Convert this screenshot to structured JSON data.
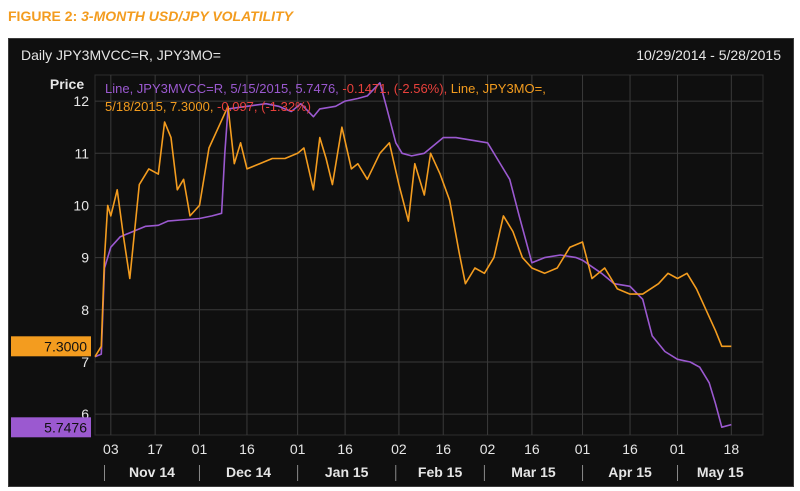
{
  "caption": {
    "figure": "FIGURE 2:",
    "title": "3-MONTH USD/JPY VOLATILITY"
  },
  "header": {
    "instrument": "Daily JPY3MVCC=R, JPY3MO=",
    "range": "10/29/2014 - 5/28/2015"
  },
  "legend": {
    "line1_purple": "Line, JPY3MVCC=R, 5/15/2015, 5.7476,",
    "line1_red": "-0.1471, (-2.56%),",
    "line1_orange": "Line, JPY3MO=,",
    "line2_orange": "5/18/2015, 7.3000,",
    "line2_red": "-0.097, (-1.32%)"
  },
  "colors": {
    "purple": "#9b59d0",
    "orange": "#f39c1f",
    "red": "#e8413c",
    "background": "#0f0f0f",
    "grid": "#3a3a3a",
    "text": "#e6e6e6",
    "caption": "#f39c1f"
  },
  "chart_data": {
    "type": "line",
    "ylabel": "Price",
    "ylim": [
      5.6,
      12.5
    ],
    "yticks": [
      6,
      7,
      8,
      9,
      10,
      11,
      12
    ],
    "x_start": "2014-10-29",
    "x_end": "2015-05-28",
    "xticks": [
      {
        "date": "2014-11-03",
        "label": "03"
      },
      {
        "date": "2014-11-17",
        "label": "17"
      },
      {
        "date": "2014-12-01",
        "label": "01"
      },
      {
        "date": "2014-12-16",
        "label": "16"
      },
      {
        "date": "2015-01-01",
        "label": "01"
      },
      {
        "date": "2015-01-16",
        "label": "16"
      },
      {
        "date": "2015-02-02",
        "label": "02"
      },
      {
        "date": "2015-02-16",
        "label": "16"
      },
      {
        "date": "2015-03-02",
        "label": "02"
      },
      {
        "date": "2015-03-16",
        "label": "16"
      },
      {
        "date": "2015-04-01",
        "label": "01"
      },
      {
        "date": "2015-04-16",
        "label": "16"
      },
      {
        "date": "2015-05-01",
        "label": "01"
      },
      {
        "date": "2015-05-18",
        "label": "18"
      }
    ],
    "months": [
      {
        "label": "Nov 14",
        "start": "2014-11-01",
        "end": "2014-12-01"
      },
      {
        "label": "Dec 14",
        "start": "2014-12-01",
        "end": "2015-01-01"
      },
      {
        "label": "Jan 15",
        "start": "2015-01-01",
        "end": "2015-02-01"
      },
      {
        "label": "Feb 15",
        "start": "2015-02-01",
        "end": "2015-03-01"
      },
      {
        "label": "Mar 15",
        "start": "2015-03-01",
        "end": "2015-04-01"
      },
      {
        "label": "Apr 15",
        "start": "2015-04-01",
        "end": "2015-05-01"
      },
      {
        "label": "May 15",
        "start": "2015-05-01",
        "end": "2015-05-28"
      }
    ],
    "series": [
      {
        "name": "JPY3MVCC=R",
        "color": "#9b59d0",
        "last_value": "5.7476",
        "points": [
          [
            "2014-10-29",
            7.1
          ],
          [
            "2014-10-31",
            7.15
          ],
          [
            "2014-11-01",
            8.8
          ],
          [
            "2014-11-03",
            9.2
          ],
          [
            "2014-11-06",
            9.4
          ],
          [
            "2014-11-10",
            9.5
          ],
          [
            "2014-11-14",
            9.6
          ],
          [
            "2014-11-18",
            9.62
          ],
          [
            "2014-11-21",
            9.7
          ],
          [
            "2014-11-25",
            9.72
          ],
          [
            "2014-12-01",
            9.75
          ],
          [
            "2014-12-05",
            9.8
          ],
          [
            "2014-12-08",
            9.85
          ],
          [
            "2014-12-09",
            11.0
          ],
          [
            "2014-12-10",
            11.85
          ],
          [
            "2014-12-16",
            11.9
          ],
          [
            "2014-12-22",
            11.95
          ],
          [
            "2014-12-26",
            11.9
          ],
          [
            "2014-12-30",
            11.8
          ],
          [
            "2015-01-02",
            11.95
          ],
          [
            "2015-01-06",
            11.7
          ],
          [
            "2015-01-08",
            11.85
          ],
          [
            "2015-01-13",
            11.9
          ],
          [
            "2015-01-16",
            12.0
          ],
          [
            "2015-01-20",
            12.05
          ],
          [
            "2015-01-23",
            12.1
          ],
          [
            "2015-01-27",
            12.35
          ],
          [
            "2015-01-29",
            11.9
          ],
          [
            "2015-02-01",
            11.2
          ],
          [
            "2015-02-03",
            11.0
          ],
          [
            "2015-02-06",
            10.95
          ],
          [
            "2015-02-10",
            11.0
          ],
          [
            "2015-02-16",
            11.3
          ],
          [
            "2015-02-20",
            11.3
          ],
          [
            "2015-02-25",
            11.25
          ],
          [
            "2015-03-02",
            11.2
          ],
          [
            "2015-03-05",
            10.9
          ],
          [
            "2015-03-09",
            10.5
          ],
          [
            "2015-03-12",
            9.8
          ],
          [
            "2015-03-16",
            8.9
          ],
          [
            "2015-03-20",
            9.0
          ],
          [
            "2015-03-25",
            9.05
          ],
          [
            "2015-03-30",
            9.0
          ],
          [
            "2015-04-01",
            8.95
          ],
          [
            "2015-04-07",
            8.7
          ],
          [
            "2015-04-11",
            8.5
          ],
          [
            "2015-04-16",
            8.45
          ],
          [
            "2015-04-20",
            8.2
          ],
          [
            "2015-04-23",
            7.5
          ],
          [
            "2015-04-27",
            7.2
          ],
          [
            "2015-05-01",
            7.05
          ],
          [
            "2015-05-05",
            7.0
          ],
          [
            "2015-05-08",
            6.9
          ],
          [
            "2015-05-11",
            6.6
          ],
          [
            "2015-05-13",
            6.2
          ],
          [
            "2015-05-15",
            5.75
          ],
          [
            "2015-05-18",
            5.8
          ]
        ]
      },
      {
        "name": "JPY3MO=",
        "color": "#f39c1f",
        "last_value": "7.3000",
        "points": [
          [
            "2014-10-29",
            7.1
          ],
          [
            "2014-10-31",
            7.3
          ],
          [
            "2014-11-01",
            9.0
          ],
          [
            "2014-11-02",
            10.0
          ],
          [
            "2014-11-03",
            9.8
          ],
          [
            "2014-11-05",
            10.3
          ],
          [
            "2014-11-07",
            9.4
          ],
          [
            "2014-11-09",
            8.6
          ],
          [
            "2014-11-12",
            10.4
          ],
          [
            "2014-11-15",
            10.7
          ],
          [
            "2014-11-18",
            10.6
          ],
          [
            "2014-11-20",
            11.6
          ],
          [
            "2014-11-22",
            11.3
          ],
          [
            "2014-11-24",
            10.3
          ],
          [
            "2014-11-26",
            10.5
          ],
          [
            "2014-11-28",
            9.8
          ],
          [
            "2014-12-01",
            10.0
          ],
          [
            "2014-12-04",
            11.1
          ],
          [
            "2014-12-07",
            11.5
          ],
          [
            "2014-12-10",
            11.9
          ],
          [
            "2014-12-12",
            10.8
          ],
          [
            "2014-12-14",
            11.2
          ],
          [
            "2014-12-16",
            10.7
          ],
          [
            "2014-12-20",
            10.8
          ],
          [
            "2014-12-24",
            10.9
          ],
          [
            "2014-12-28",
            10.9
          ],
          [
            "2015-01-01",
            11.0
          ],
          [
            "2015-01-03",
            11.1
          ],
          [
            "2015-01-06",
            10.3
          ],
          [
            "2015-01-08",
            11.3
          ],
          [
            "2015-01-10",
            10.9
          ],
          [
            "2015-01-12",
            10.4
          ],
          [
            "2015-01-15",
            11.5
          ],
          [
            "2015-01-18",
            10.7
          ],
          [
            "2015-01-20",
            10.8
          ],
          [
            "2015-01-23",
            10.5
          ],
          [
            "2015-01-27",
            11.0
          ],
          [
            "2015-01-30",
            11.2
          ],
          [
            "2015-02-02",
            10.4
          ],
          [
            "2015-02-05",
            9.7
          ],
          [
            "2015-02-07",
            10.8
          ],
          [
            "2015-02-10",
            10.2
          ],
          [
            "2015-02-12",
            11.0
          ],
          [
            "2015-02-15",
            10.6
          ],
          [
            "2015-02-18",
            10.1
          ],
          [
            "2015-02-21",
            9.1
          ],
          [
            "2015-02-23",
            8.5
          ],
          [
            "2015-02-26",
            8.8
          ],
          [
            "2015-03-01",
            8.7
          ],
          [
            "2015-03-04",
            9.0
          ],
          [
            "2015-03-07",
            9.8
          ],
          [
            "2015-03-10",
            9.5
          ],
          [
            "2015-03-13",
            9.0
          ],
          [
            "2015-03-16",
            8.8
          ],
          [
            "2015-03-20",
            8.7
          ],
          [
            "2015-03-24",
            8.8
          ],
          [
            "2015-03-28",
            9.2
          ],
          [
            "2015-04-01",
            9.3
          ],
          [
            "2015-04-04",
            8.6
          ],
          [
            "2015-04-08",
            8.8
          ],
          [
            "2015-04-12",
            8.4
          ],
          [
            "2015-04-16",
            8.3
          ],
          [
            "2015-04-20",
            8.3
          ],
          [
            "2015-04-25",
            8.5
          ],
          [
            "2015-04-28",
            8.7
          ],
          [
            "2015-05-01",
            8.6
          ],
          [
            "2015-05-04",
            8.7
          ],
          [
            "2015-05-07",
            8.4
          ],
          [
            "2015-05-10",
            8.0
          ],
          [
            "2015-05-13",
            7.6
          ],
          [
            "2015-05-15",
            7.3
          ],
          [
            "2015-05-18",
            7.3
          ]
        ]
      }
    ]
  }
}
